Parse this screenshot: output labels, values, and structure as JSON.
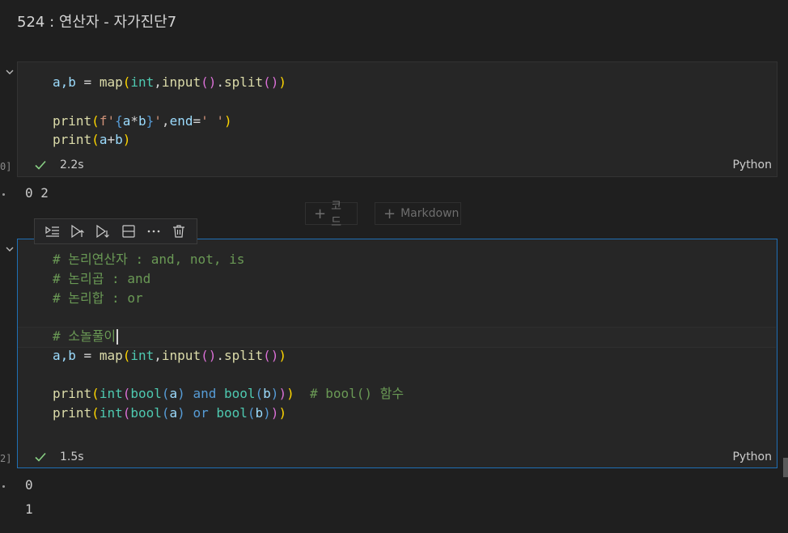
{
  "markdown_title": "524 : 연산자 - 자가진단7",
  "cell1": {
    "lines": [
      [
        [
          "a,b",
          "kw-p"
        ],
        [
          " = ",
          "kw-n"
        ],
        [
          "map",
          "kw-f"
        ],
        [
          "(",
          "kw-y"
        ],
        [
          "int",
          "kw-b"
        ],
        [
          ",",
          "kw-n"
        ],
        [
          "input",
          "kw-f"
        ],
        [
          "()",
          "kw-br"
        ],
        [
          ".",
          "kw-n"
        ],
        [
          "split",
          "kw-f"
        ],
        [
          "()",
          "kw-br"
        ],
        [
          ")",
          "kw-y"
        ]
      ],
      [],
      [
        [
          "print",
          "kw-f"
        ],
        [
          "(",
          "kw-y"
        ],
        [
          "f'",
          "kw-s"
        ],
        [
          "{",
          "kw-k"
        ],
        [
          "a",
          "kw-p"
        ],
        [
          "*",
          "kw-n"
        ],
        [
          "b",
          "kw-p"
        ],
        [
          "}",
          "kw-k"
        ],
        [
          "'",
          "kw-s"
        ],
        [
          ",",
          "kw-n"
        ],
        [
          "end",
          "kw-p"
        ],
        [
          "=",
          "kw-n"
        ],
        [
          "' '",
          "kw-s"
        ],
        [
          ")",
          "kw-y"
        ]
      ],
      [
        [
          "print",
          "kw-f"
        ],
        [
          "(",
          "kw-y"
        ],
        [
          "a",
          "kw-p"
        ],
        [
          "+",
          "kw-n"
        ],
        [
          "b",
          "kw-p"
        ],
        [
          ")",
          "kw-y"
        ]
      ]
    ],
    "exec_count": "0]",
    "duration": "2.2s",
    "language": "Python",
    "output": "0 2"
  },
  "add_code_label": "코드",
  "add_markdown_label": "Markdown",
  "toolbar_icons": [
    "run-by-line-icon",
    "execute-above-icon",
    "execute-below-icon",
    "split-cell-icon",
    "more-actions-icon",
    "delete-icon"
  ],
  "cell2": {
    "lines": [
      [
        [
          "# 논리연산자 : and, not, is",
          "kw-c"
        ]
      ],
      [
        [
          "# 논리곱 : and",
          "kw-c"
        ]
      ],
      [
        [
          "# 논리합 : or",
          "kw-c"
        ]
      ],
      [],
      [
        [
          "# 소놀풀이",
          "kw-c"
        ]
      ],
      [
        [
          "a,b",
          "kw-p"
        ],
        [
          " = ",
          "kw-n"
        ],
        [
          "map",
          "kw-f"
        ],
        [
          "(",
          "kw-y"
        ],
        [
          "int",
          "kw-b"
        ],
        [
          ",",
          "kw-n"
        ],
        [
          "input",
          "kw-f"
        ],
        [
          "()",
          "kw-br"
        ],
        [
          ".",
          "kw-n"
        ],
        [
          "split",
          "kw-f"
        ],
        [
          "()",
          "kw-br"
        ],
        [
          ")",
          "kw-y"
        ]
      ],
      [],
      [
        [
          "print",
          "kw-f"
        ],
        [
          "(",
          "kw-y"
        ],
        [
          "int",
          "kw-b"
        ],
        [
          "(",
          "kw-br"
        ],
        [
          "bool",
          "kw-b"
        ],
        [
          "(",
          "kw-k"
        ],
        [
          "a",
          "kw-p"
        ],
        [
          ")",
          "kw-k"
        ],
        [
          " and ",
          "kw-k"
        ],
        [
          "bool",
          "kw-b"
        ],
        [
          "(",
          "kw-k"
        ],
        [
          "b",
          "kw-p"
        ],
        [
          ")",
          "kw-k"
        ],
        [
          ")",
          "kw-br"
        ],
        [
          ")",
          "kw-y"
        ],
        [
          "  # bool() 함수",
          "kw-c"
        ]
      ],
      [
        [
          "print",
          "kw-f"
        ],
        [
          "(",
          "kw-y"
        ],
        [
          "int",
          "kw-b"
        ],
        [
          "(",
          "kw-br"
        ],
        [
          "bool",
          "kw-b"
        ],
        [
          "(",
          "kw-k"
        ],
        [
          "a",
          "kw-p"
        ],
        [
          ")",
          "kw-k"
        ],
        [
          " or ",
          "kw-k"
        ],
        [
          "bool",
          "kw-b"
        ],
        [
          "(",
          "kw-k"
        ],
        [
          "b",
          "kw-p"
        ],
        [
          ")",
          "kw-k"
        ],
        [
          ")",
          "kw-br"
        ],
        [
          ")",
          "kw-y"
        ]
      ]
    ],
    "exec_count": "2]",
    "duration": "1.5s",
    "language": "Python",
    "outputs": [
      "0",
      "1"
    ]
  }
}
